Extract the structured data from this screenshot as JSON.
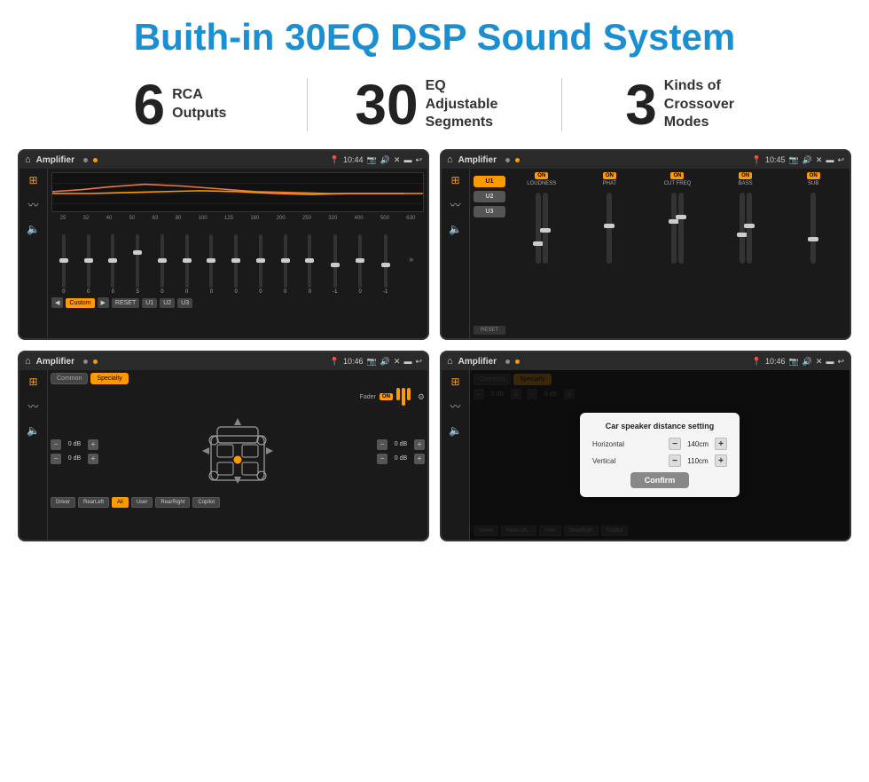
{
  "page": {
    "title": "Buith-in 30EQ DSP Sound System",
    "stats": [
      {
        "number": "6",
        "label": "RCA\nOutputs"
      },
      {
        "number": "30",
        "label": "EQ Adjustable\nSegments"
      },
      {
        "number": "3",
        "label": "Kinds of\nCrossover Modes"
      }
    ]
  },
  "screens": {
    "eq": {
      "title": "Amplifier",
      "time": "10:44",
      "freq_labels": [
        "25",
        "32",
        "40",
        "50",
        "63",
        "80",
        "100",
        "125",
        "160",
        "200",
        "250",
        "320",
        "400",
        "500",
        "630"
      ],
      "values": [
        "0",
        "0",
        "0",
        "5",
        "0",
        "0",
        "0",
        "0",
        "0",
        "0",
        "0",
        "-1",
        "0",
        "-1"
      ],
      "preset": "Custom",
      "buttons": [
        "RESET",
        "U1",
        "U2",
        "U3"
      ]
    },
    "amplifier": {
      "title": "Amplifier",
      "time": "10:45",
      "presets": [
        "U1",
        "U2",
        "U3"
      ],
      "channels": [
        {
          "toggle": "ON",
          "label": "LOUDNESS"
        },
        {
          "toggle": "ON",
          "label": "PHAT"
        },
        {
          "toggle": "ON",
          "label": "CUT FREQ"
        },
        {
          "toggle": "ON",
          "label": "BASS"
        },
        {
          "toggle": "ON",
          "label": "SUB"
        }
      ],
      "reset_label": "RESET"
    },
    "common": {
      "title": "Amplifier",
      "time": "10:46",
      "tabs": [
        "Common",
        "Specialty"
      ],
      "fader_label": "Fader",
      "toggle": "ON",
      "db_values": [
        "0 dB",
        "0 dB",
        "0 dB",
        "0 dB"
      ],
      "bottom_buttons": [
        "Driver",
        "RearLeft",
        "All",
        "User",
        "RearRight",
        "Copilot"
      ]
    },
    "distance": {
      "title": "Amplifier",
      "time": "10:46",
      "tabs": [
        "Common",
        "Specialty"
      ],
      "dialog": {
        "title": "Car speaker distance setting",
        "horizontal_label": "Horizontal",
        "horizontal_value": "140cm",
        "vertical_label": "Vertical",
        "vertical_value": "110cm",
        "confirm_label": "Confirm"
      },
      "bottom_buttons": [
        "Driver",
        "RearLeft",
        "All",
        "User",
        "RearRight",
        "Copilot"
      ]
    }
  }
}
